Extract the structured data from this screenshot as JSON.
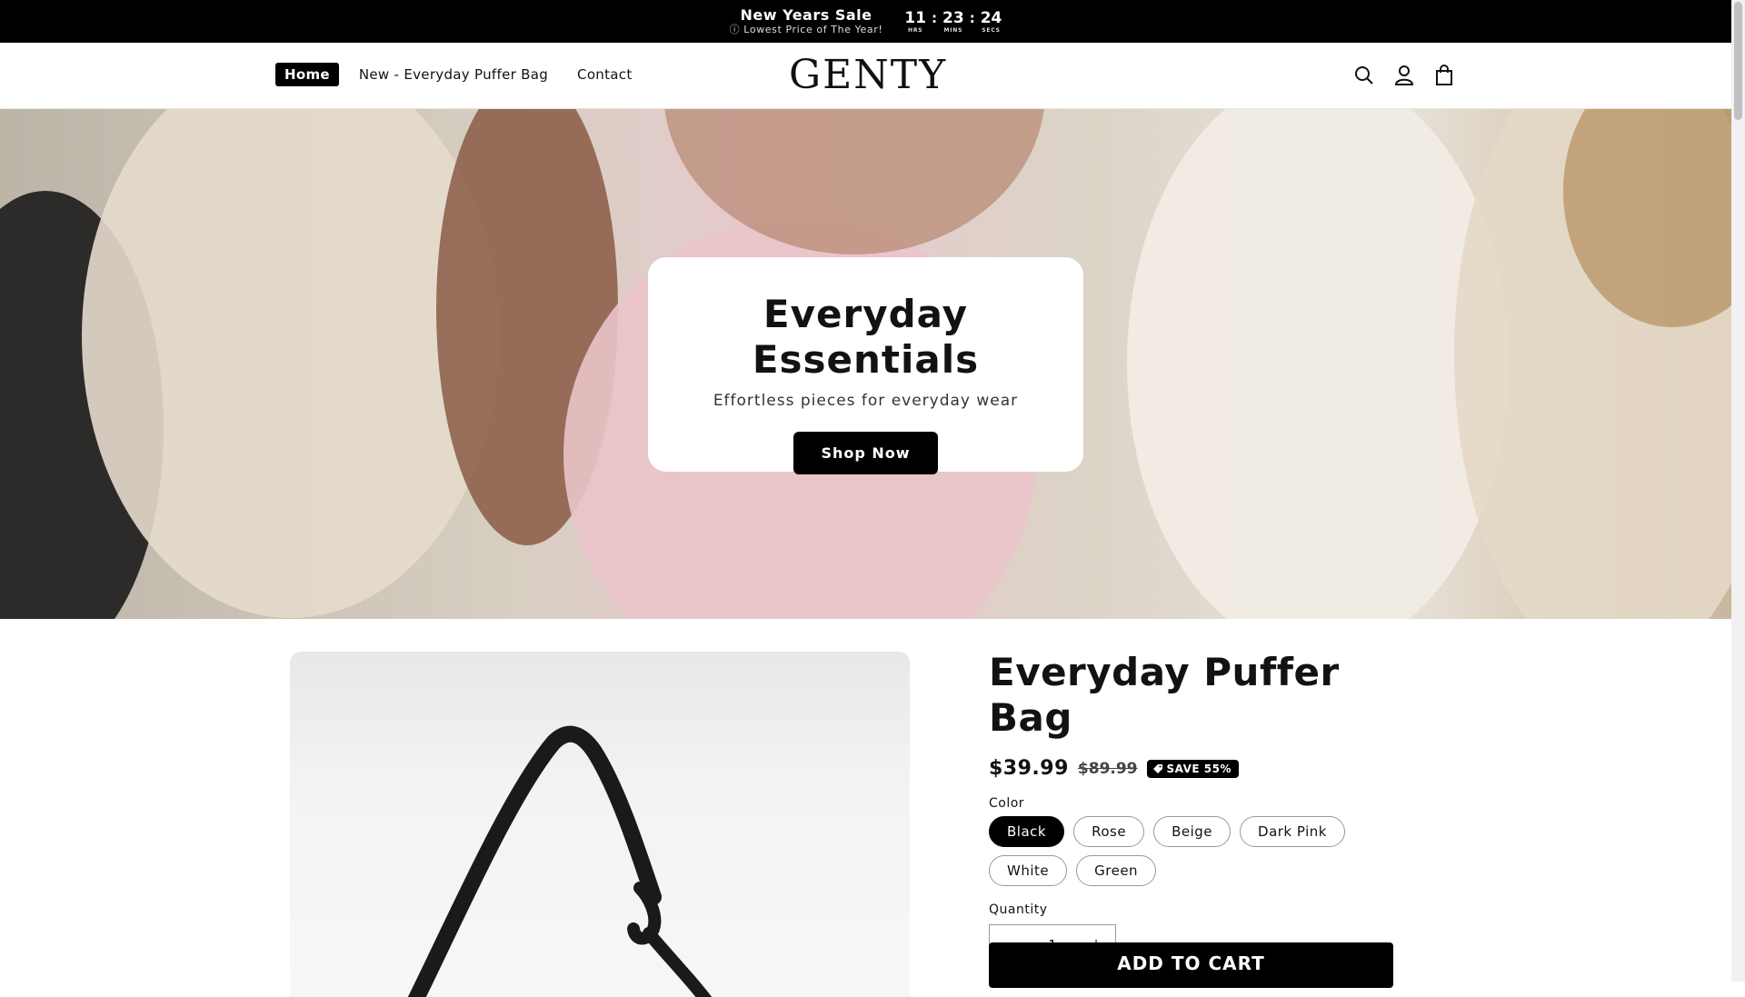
{
  "announcement": {
    "title": "New Years Sale",
    "subtitle": "ⓘ Lowest Price of The Year!",
    "countdown": {
      "hours": "11",
      "hours_label": "HRS",
      "minutes": "23",
      "minutes_label": "MINS",
      "seconds": "24",
      "seconds_label": "SECS",
      "separator": ":"
    }
  },
  "header": {
    "nav": [
      "Home",
      "New - Everyday Puffer Bag",
      "Contact"
    ],
    "active_nav": "Home",
    "logo": "GENTY",
    "icons": [
      "search-icon",
      "account-icon",
      "cart-icon"
    ]
  },
  "hero": {
    "title": "Everyday Essentials",
    "subtitle": "Effortless pieces for everyday wear",
    "button": "Shop Now"
  },
  "product": {
    "title": "Everyday Puffer Bag",
    "price": "$39.99",
    "compare_price": "$89.99",
    "save_badge": "SAVE 55%",
    "color_label": "Color",
    "colors": [
      "Black",
      "Rose",
      "Beige",
      "Dark Pink",
      "White",
      "Green"
    ],
    "selected_color": "Black",
    "quantity_label": "Quantity",
    "quantity": "1",
    "minus": "−",
    "plus": "+",
    "add_to_cart": "ADD TO CART"
  },
  "colors": {
    "accent": "#000000",
    "background": "#ffffff",
    "text": "#121212"
  }
}
